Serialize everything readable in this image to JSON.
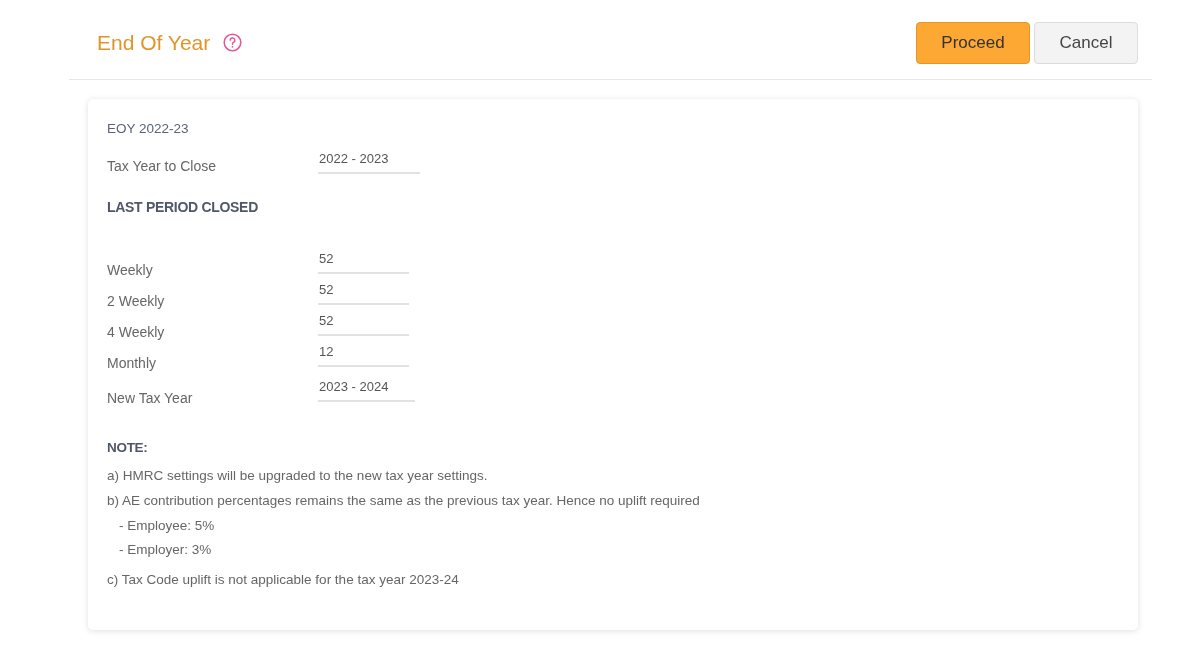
{
  "header": {
    "title": "End Of Year",
    "buttons": [
      {
        "label": "Proceed",
        "kind": "primary"
      },
      {
        "label": "Cancel",
        "kind": "secondary"
      }
    ]
  },
  "form": {
    "heading": "EOY 2022-23",
    "tax_year_to_close": {
      "label": "Tax Year to Close",
      "value": "2022 - 2023"
    },
    "section_title": "LAST PERIOD CLOSED",
    "periods": [
      {
        "label": "Weekly",
        "value": "52"
      },
      {
        "label": "2 Weekly",
        "value": "52"
      },
      {
        "label": "4 Weekly",
        "value": "52"
      },
      {
        "label": "Monthly",
        "value": "12"
      }
    ],
    "new_tax_year": {
      "label": "New Tax Year",
      "value": "2023 - 2024"
    },
    "note_title": "NOTE:",
    "notes": [
      {
        "kind": "item",
        "text": "a) HMRC settings will be upgraded to the new tax year settings."
      },
      {
        "kind": "item",
        "text": "b) AE contribution percentages remains the same as the previous tax year. Hence no uplift required"
      },
      {
        "kind": "sub",
        "text": "- Employee: 5%"
      },
      {
        "kind": "sub",
        "text": "- Employer: 3%"
      },
      {
        "kind": "item",
        "text": "c) Tax Code uplift is not applicable for the tax year 2023-24"
      }
    ]
  }
}
